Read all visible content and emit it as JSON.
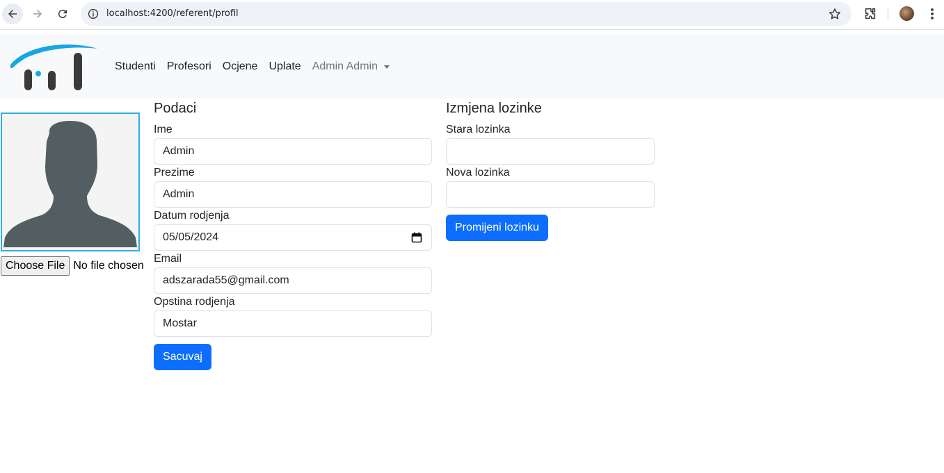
{
  "browser": {
    "url": "localhost:4200/referent/profil"
  },
  "navbar": {
    "links": [
      "Studenti",
      "Profesori",
      "Ocjene",
      "Uplate"
    ],
    "user_menu": "Admin Admin"
  },
  "profile_image": {
    "file_button": "Choose File",
    "file_status": "No file chosen"
  },
  "podaci": {
    "title": "Podaci",
    "fields": [
      {
        "label": "Ime",
        "value": "Admin"
      },
      {
        "label": "Prezime",
        "value": "Admin"
      },
      {
        "label": "Datum rodjenja",
        "value": "05/05/2024"
      },
      {
        "label": "Email",
        "value": "adszarada55@gmail.com"
      },
      {
        "label": "Opstina rodjenja",
        "value": "Mostar"
      }
    ],
    "save_label": "Sacuvaj"
  },
  "password": {
    "title": "Izmjena lozinke",
    "old_label": "Stara lozinka",
    "old_value": "",
    "new_label": "Nova lozinka",
    "new_value": "",
    "submit_label": "Promijeni lozinku"
  },
  "colors": {
    "primary": "#0d6efd",
    "navbar_bg": "#f8f9fa",
    "photo_border": "#2bb0e0",
    "logo_blue": "#16a6e6",
    "logo_dark": "#3a3a3a"
  }
}
